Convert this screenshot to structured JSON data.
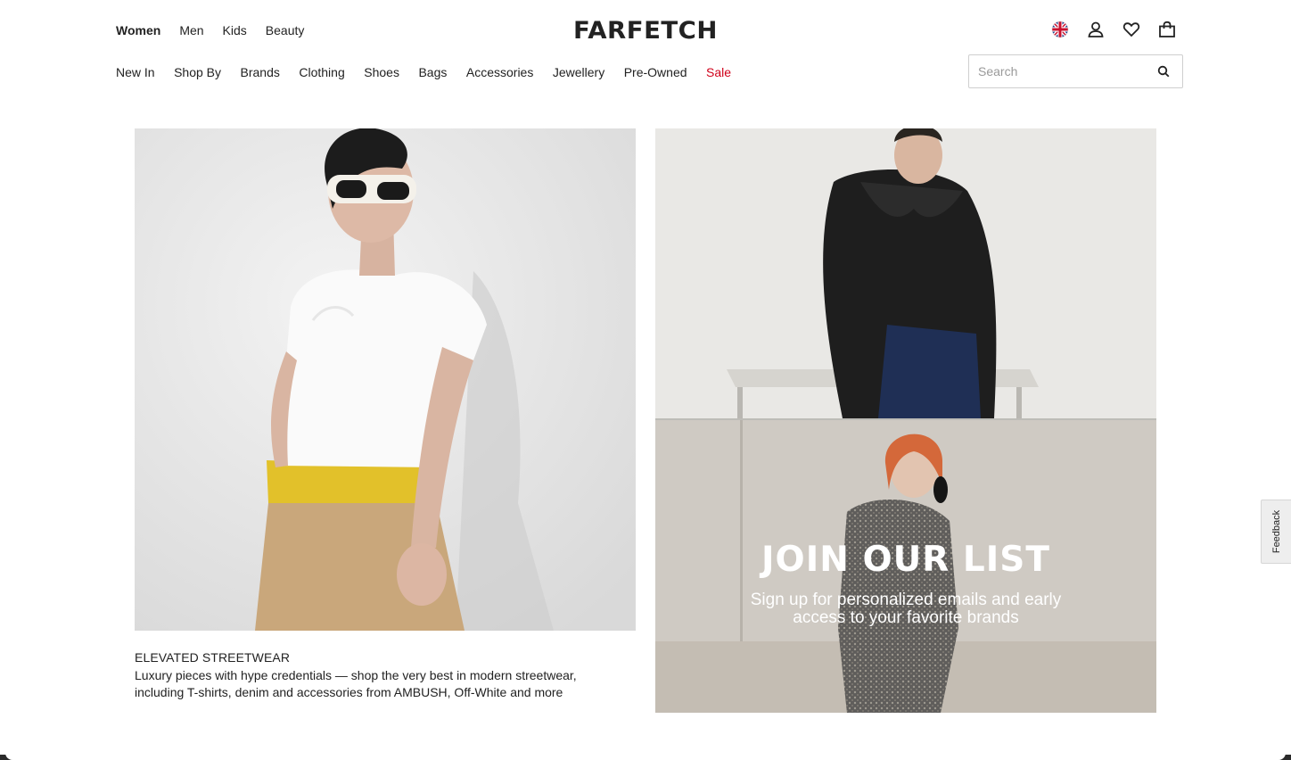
{
  "header": {
    "gender_tabs": [
      {
        "label": "Women",
        "active": true
      },
      {
        "label": "Men",
        "active": false
      },
      {
        "label": "Kids",
        "active": false
      },
      {
        "label": "Beauty",
        "active": false
      }
    ],
    "logo": "FARFETCH",
    "icons": [
      "uk-flag-icon",
      "account-icon",
      "wishlist-heart-icon",
      "shopping-bag-icon"
    ],
    "categories": [
      {
        "label": "New In"
      },
      {
        "label": "Shop By"
      },
      {
        "label": "Brands"
      },
      {
        "label": "Clothing"
      },
      {
        "label": "Shoes"
      },
      {
        "label": "Bags"
      },
      {
        "label": "Accessories"
      },
      {
        "label": "Jewellery"
      },
      {
        "label": "Pre-Owned"
      },
      {
        "label": "Sale",
        "color": "#d0021b"
      }
    ],
    "search": {
      "placeholder": "Search",
      "value": ""
    }
  },
  "hero_left": {
    "title": "ELEVATED STREETWEAR",
    "description_line1": "Luxury pieces with hype credentials — shop the very best in modern streetwear,",
    "description_line2": "including T-shirts, denim and accessories from AMBUSH, Off-White and more"
  },
  "hero_right": {
    "title": "JOIN OUR LIST",
    "subtitle_line1": "Sign up for personalized emails and early",
    "subtitle_line2": "access to your favorite brands"
  },
  "feedback_tab": {
    "label": "Feedback"
  },
  "colors": {
    "text": "#222222",
    "sale": "#d0021b",
    "border": "#cfcfcf"
  }
}
